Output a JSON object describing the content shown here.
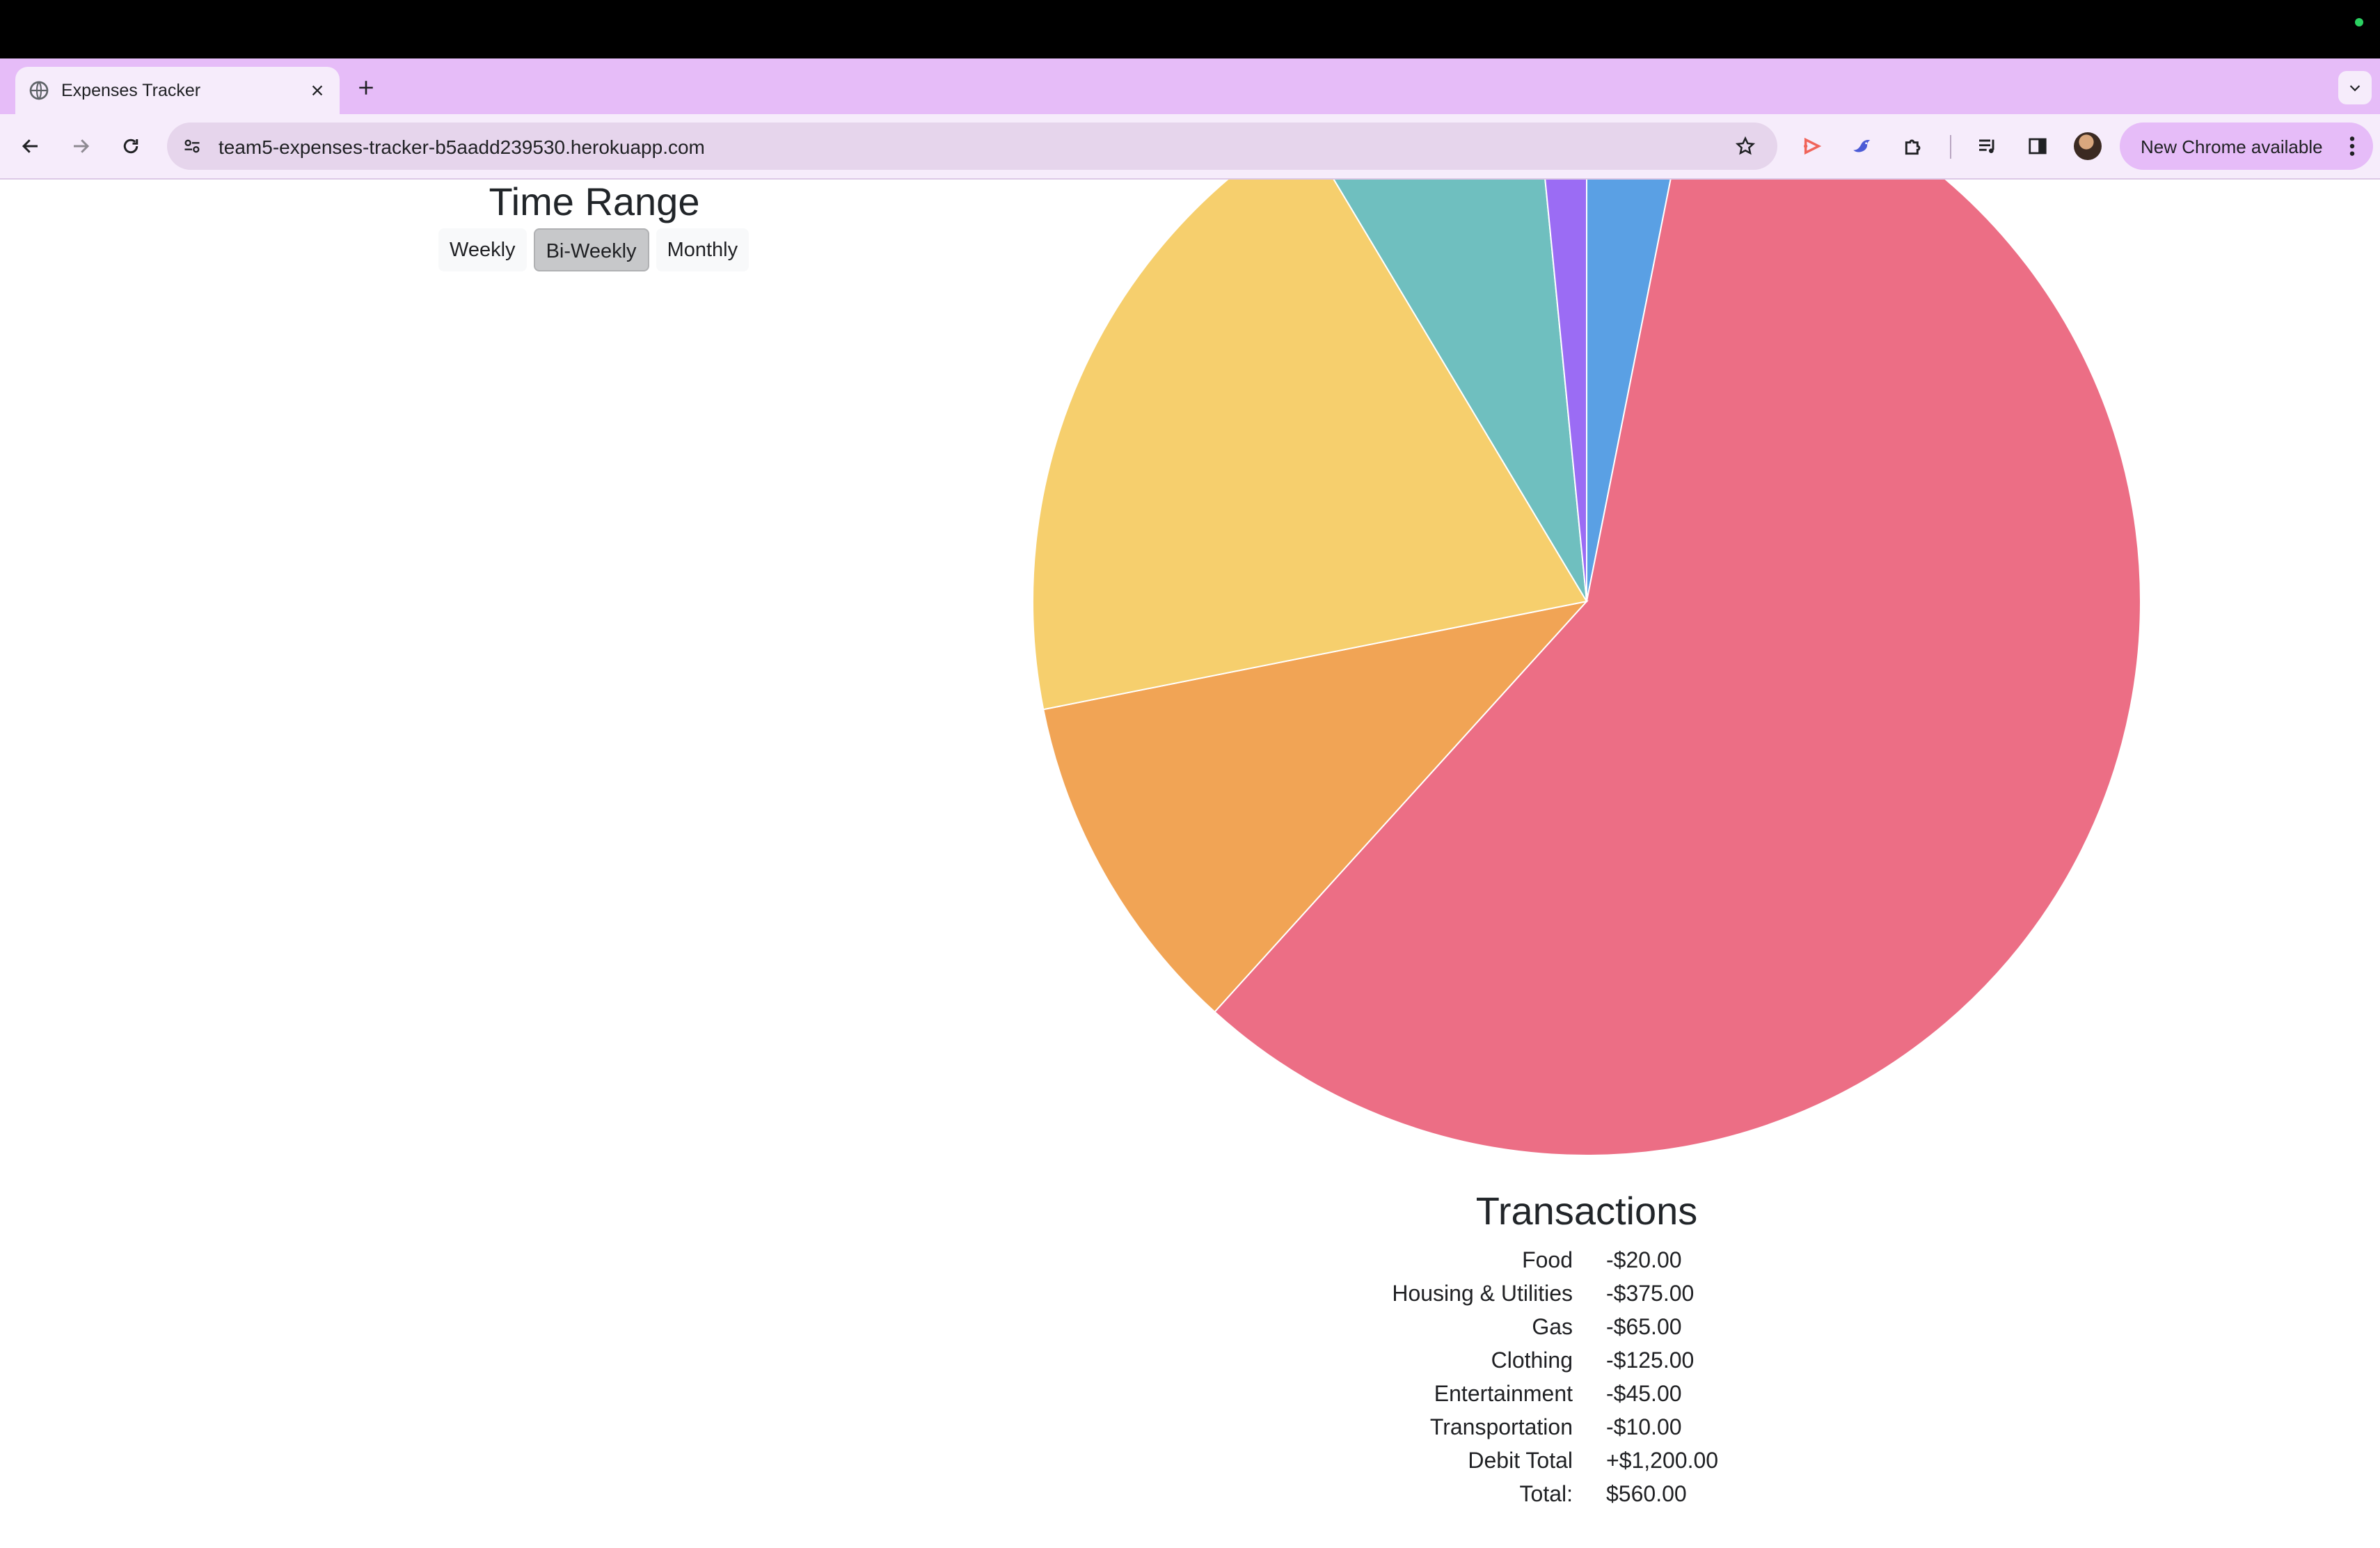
{
  "browser": {
    "tab_title": "Expenses Tracker",
    "url": "team5-expenses-tracker-b5aadd239530.herokuapp.com",
    "update_button_label": "New Chrome available",
    "icons": {
      "favicon": "globe-icon",
      "close": "close-icon",
      "new_tab": "plus-icon",
      "tab_search": "chevron-down-icon",
      "back": "back-arrow-icon",
      "forward": "forward-arrow-icon",
      "reload": "reload-icon",
      "site_info": "tune-icon",
      "bookmark": "star-icon",
      "extensions": [
        "play-extension-icon",
        "bird-extension-icon",
        "puzzle-icon",
        "media-queue-icon",
        "side-panel-icon"
      ],
      "menu": "kebab-icon"
    },
    "colors": {
      "tab_strip": "#e6bcf8",
      "toolbar": "#f6ecfb",
      "omnibox": "#e6d5ec"
    }
  },
  "time_range": {
    "title": "Time Range",
    "options": [
      "Weekly",
      "Bi-Weekly",
      "Monthly"
    ],
    "selected": "Bi-Weekly"
  },
  "chart_data": {
    "type": "pie",
    "title": "",
    "categories": [
      "Food",
      "Housing & Utilities",
      "Gas",
      "Clothing",
      "Entertainment",
      "Transportation"
    ],
    "values": [
      20,
      375,
      65,
      125,
      45,
      10
    ],
    "colors": [
      "#5aa0e4",
      "#ec6e85",
      "#f1a455",
      "#f6cf6d",
      "#6fbfbf",
      "#9b6cf4"
    ],
    "legend": "none"
  },
  "transactions": {
    "title": "Transactions",
    "rows": [
      {
        "label": "Food",
        "amount": "-$20.00"
      },
      {
        "label": "Housing & Utilities",
        "amount": "-$375.00"
      },
      {
        "label": "Gas",
        "amount": "-$65.00"
      },
      {
        "label": "Clothing",
        "amount": "-$125.00"
      },
      {
        "label": "Entertainment",
        "amount": "-$45.00"
      },
      {
        "label": "Transportation",
        "amount": "-$10.00"
      },
      {
        "label": "Debit Total",
        "amount": "+$1,200.00"
      },
      {
        "label": "Total:",
        "amount": "$560.00"
      }
    ]
  }
}
